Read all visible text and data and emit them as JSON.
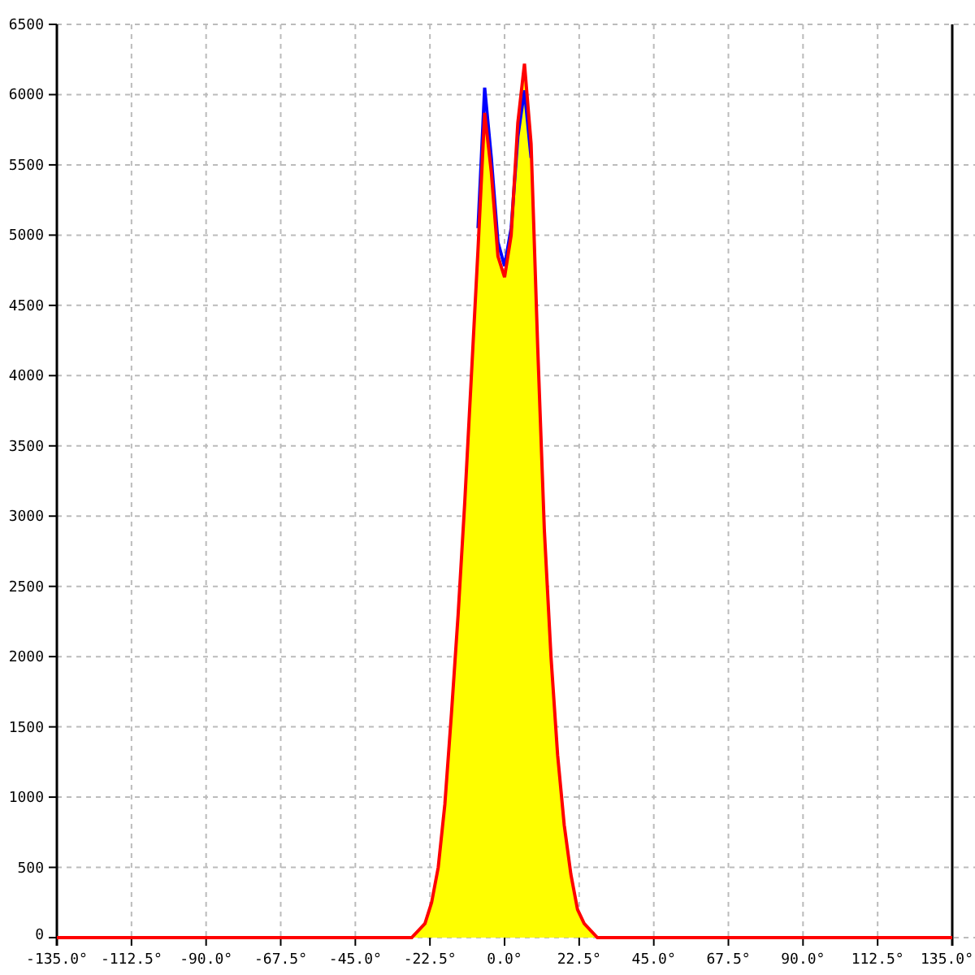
{
  "chart_data": {
    "type": "line",
    "grid": true,
    "xlim": [
      -135,
      135
    ],
    "ylim": [
      0,
      6500
    ],
    "xticks": [
      {
        "value": -135,
        "label": "-135.0°"
      },
      {
        "value": -112.5,
        "label": "-112.5°"
      },
      {
        "value": -90,
        "label": "-90.0°"
      },
      {
        "value": -67.5,
        "label": "-67.5°"
      },
      {
        "value": -45,
        "label": "-45.0°"
      },
      {
        "value": -22.5,
        "label": "-22.5°"
      },
      {
        "value": 0,
        "label": "0.0°"
      },
      {
        "value": 22.5,
        "label": "22.5°"
      },
      {
        "value": 45,
        "label": "45.0°"
      },
      {
        "value": 67.5,
        "label": "67.5°"
      },
      {
        "value": 90,
        "label": "90.0°"
      },
      {
        "value": 112.5,
        "label": "112.5°"
      },
      {
        "value": 135,
        "label": "135.0°"
      }
    ],
    "yticks": [
      0,
      500,
      1000,
      1500,
      2000,
      2500,
      3000,
      3500,
      4000,
      4500,
      5000,
      5500,
      6000,
      6500
    ],
    "x": [
      -135,
      -34,
      -32,
      -30,
      -28,
      -26,
      -24,
      -22,
      -20,
      -18,
      -16,
      -14,
      -12,
      -10,
      -8,
      -6,
      -4,
      -2,
      0,
      2,
      4,
      6,
      8,
      10,
      12,
      14,
      16,
      18,
      20,
      22,
      24,
      26,
      28,
      30,
      32,
      34,
      36,
      38,
      40,
      42,
      44,
      135
    ],
    "series": [
      {
        "color": "#0000ff",
        "values": [
          null,
          null,
          null,
          null,
          null,
          null,
          null,
          null,
          null,
          null,
          null,
          null,
          null,
          null,
          5050,
          6050,
          5550,
          4950,
          4780,
          5050,
          5700,
          6030,
          5550,
          null,
          null,
          null,
          null,
          null,
          null,
          null,
          null,
          null,
          null,
          null,
          null,
          null,
          null,
          null,
          null,
          null,
          null,
          null
        ]
      },
      {
        "color": "#ff0000",
        "values": [
          0,
          0,
          0,
          0,
          0,
          50,
          100,
          250,
          500,
          950,
          1600,
          2300,
          3100,
          4000,
          4900,
          5870,
          5450,
          4850,
          4700,
          5000,
          5800,
          6220,
          5650,
          4200,
          2900,
          2000,
          1300,
          800,
          450,
          200,
          100,
          50,
          0,
          0,
          0,
          0,
          0,
          0,
          0,
          0,
          0,
          0
        ]
      }
    ]
  }
}
